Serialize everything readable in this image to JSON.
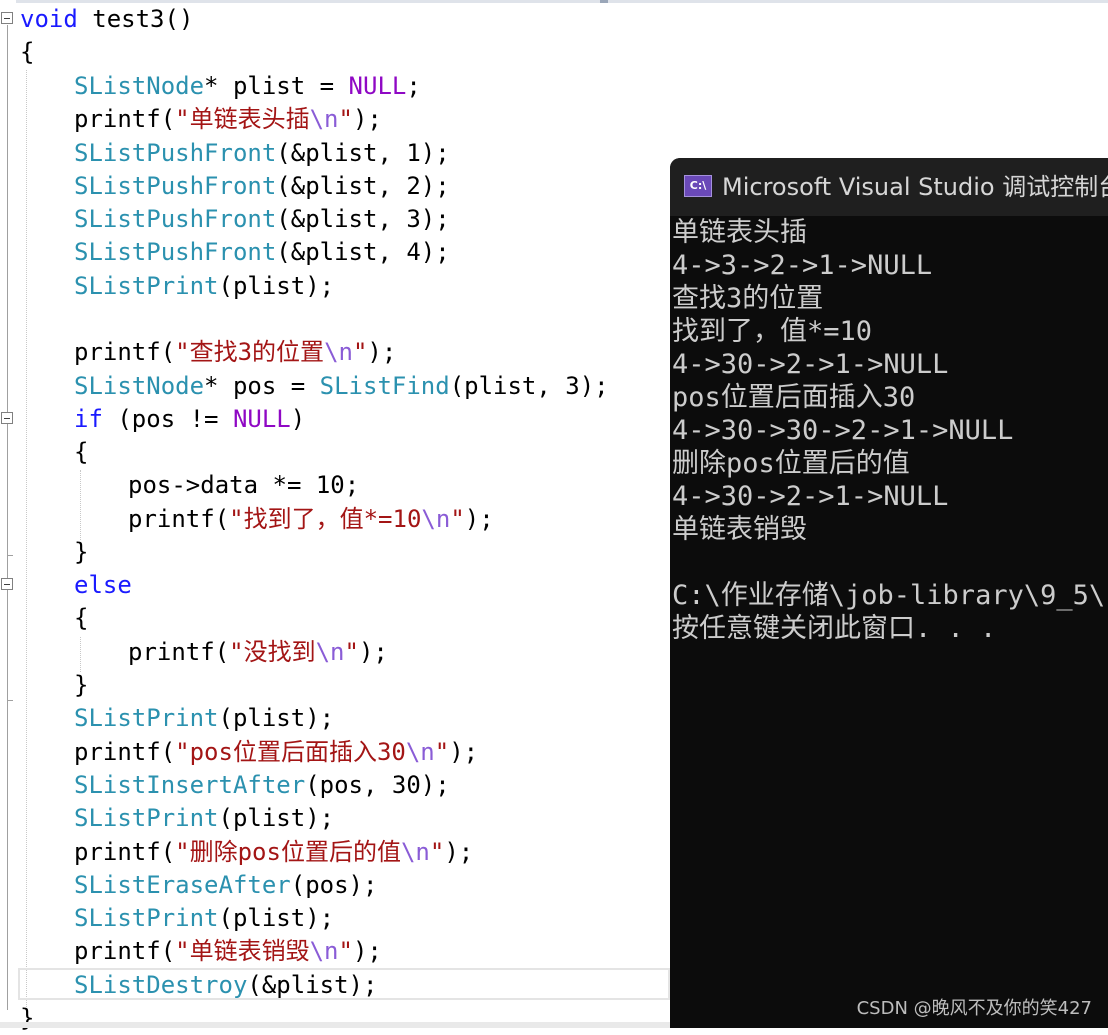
{
  "code": {
    "lines": [
      "void test3()",
      "{",
      "SListNode* plist = NULL;",
      "printf(\"单链表头插\\n\");",
      "SListPushFront(&plist, 1);",
      "SListPushFront(&plist, 2);",
      "SListPushFront(&plist, 3);",
      "SListPushFront(&plist, 4);",
      "SListPrint(plist);",
      "",
      "printf(\"查找3的位置\\n\");",
      "SListNode* pos = SListFind(plist, 3);",
      "if (pos != NULL)",
      "{",
      "pos->data *= 10;",
      "printf(\"找到了，值*=10\\n\");",
      "}",
      "else",
      "{",
      "printf(\"没找到\\n\");",
      "}",
      "SListPrint(plist);",
      "printf(\"pos位置后面插入30\\n\");",
      "SListInsertAfter(pos, 30);",
      "SListPrint(plist);",
      "printf(\"删除pos位置后的值\\n\");",
      "SListEraseAfter(pos);",
      "SListPrint(plist);",
      "printf(\"单链表销毁\\n\");",
      "SListDestroy(&plist);",
      "}"
    ]
  },
  "console": {
    "title": "Microsoft Visual Studio 调试控制台",
    "icon_label": "C:\\",
    "output": [
      "单链表头插",
      "4->3->2->1->NULL",
      "查找3的位置",
      "找到了，值*=10",
      "4->30->2->1->NULL",
      "pos位置后面插入30",
      "4->30->30->2->1->NULL",
      "删除pos位置后的值",
      "4->30->2->1->NULL",
      "单链表销毁",
      "",
      "C:\\作业存储\\job-library\\9_5\\",
      "按任意键关闭此窗口. . ."
    ]
  },
  "watermark": "CSDN @晚风不及你的笑427",
  "colors": {
    "keyword": "#1a1aff",
    "type": "#2b91af",
    "string": "#a31515",
    "escape": "#8a5cd6",
    "console_bg": "#0c0c0c",
    "console_text": "#cccccc"
  }
}
